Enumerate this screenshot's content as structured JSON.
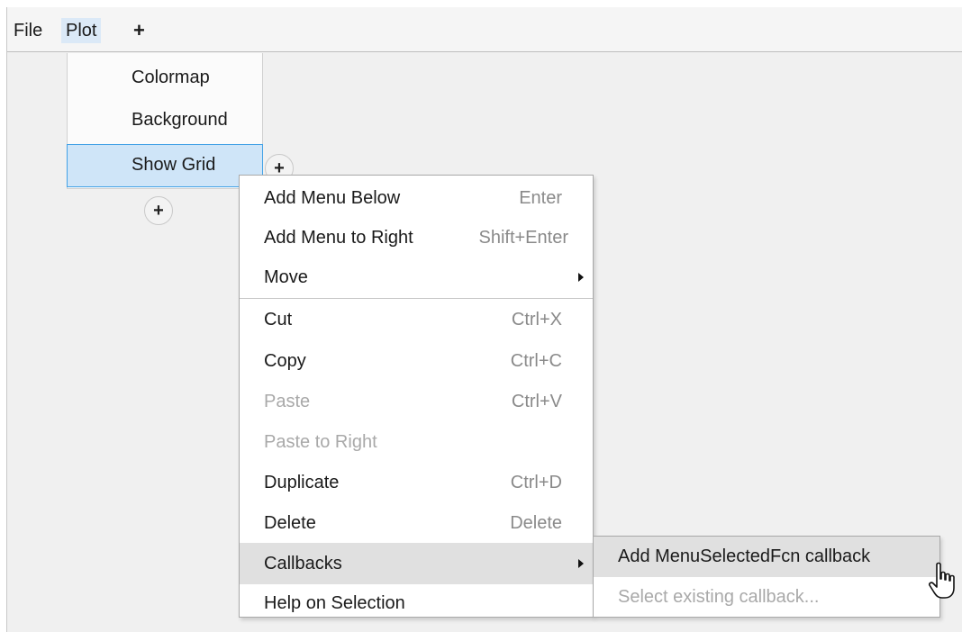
{
  "menubar": {
    "items": [
      "File",
      "Plot",
      "+"
    ]
  },
  "plot_menu": {
    "items": [
      "Colormap",
      "Background",
      "Show Grid"
    ],
    "add_right_label": "+",
    "add_below_label": "+"
  },
  "context_menu": {
    "items": [
      {
        "label": "Add Menu Below",
        "shortcut": "Enter",
        "enabled": true
      },
      {
        "label": "Add Menu to Right",
        "shortcut": "Shift+Enter",
        "enabled": true
      },
      {
        "label": "Move",
        "shortcut": "",
        "submenu": true,
        "enabled": true
      },
      {
        "label": "Cut",
        "shortcut": "Ctrl+X",
        "enabled": true
      },
      {
        "label": "Copy",
        "shortcut": "Ctrl+C",
        "enabled": true
      },
      {
        "label": "Paste",
        "shortcut": "Ctrl+V",
        "enabled": false
      },
      {
        "label": "Paste to Right",
        "shortcut": "",
        "enabled": false
      },
      {
        "label": "Duplicate",
        "shortcut": "Ctrl+D",
        "enabled": true
      },
      {
        "label": "Delete",
        "shortcut": "Delete",
        "enabled": true
      },
      {
        "label": "Callbacks",
        "shortcut": "",
        "submenu": true,
        "enabled": true,
        "highlighted": true
      },
      {
        "label": "Help on Selection",
        "shortcut": "",
        "enabled": true
      }
    ]
  },
  "callbacks_submenu": {
    "items": [
      {
        "label": "Add MenuSelectedFcn callback",
        "enabled": true,
        "highlighted": true
      },
      {
        "label": "Select existing callback...",
        "enabled": false
      }
    ]
  },
  "colors": {
    "selection_fill": "#cfe5f8",
    "selection_border": "#43a2e6",
    "hover_fill": "#e0e0e0",
    "disabled_text": "#a9a9a9"
  }
}
